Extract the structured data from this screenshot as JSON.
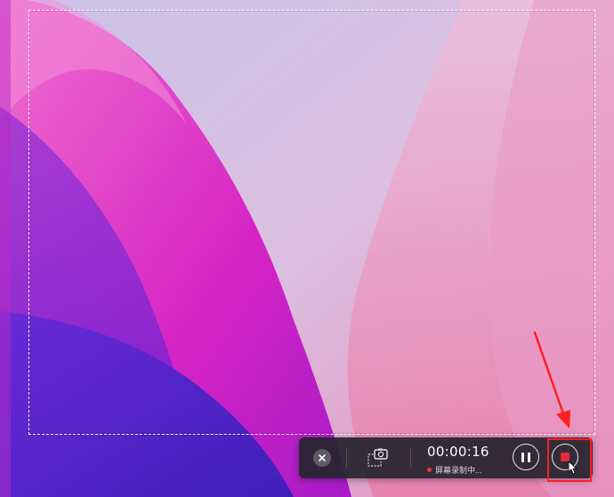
{
  "recorder": {
    "timer": "00:00:16",
    "status_text": "屏幕录制中...",
    "status_color": "#e8383d",
    "stop_color": "#e32c35",
    "icons": {
      "close": "close-icon",
      "screenshot": "camera-region-icon",
      "pause": "pause-icon",
      "stop": "stop-icon"
    }
  },
  "annotation": {
    "color": "#ff1f1f"
  }
}
